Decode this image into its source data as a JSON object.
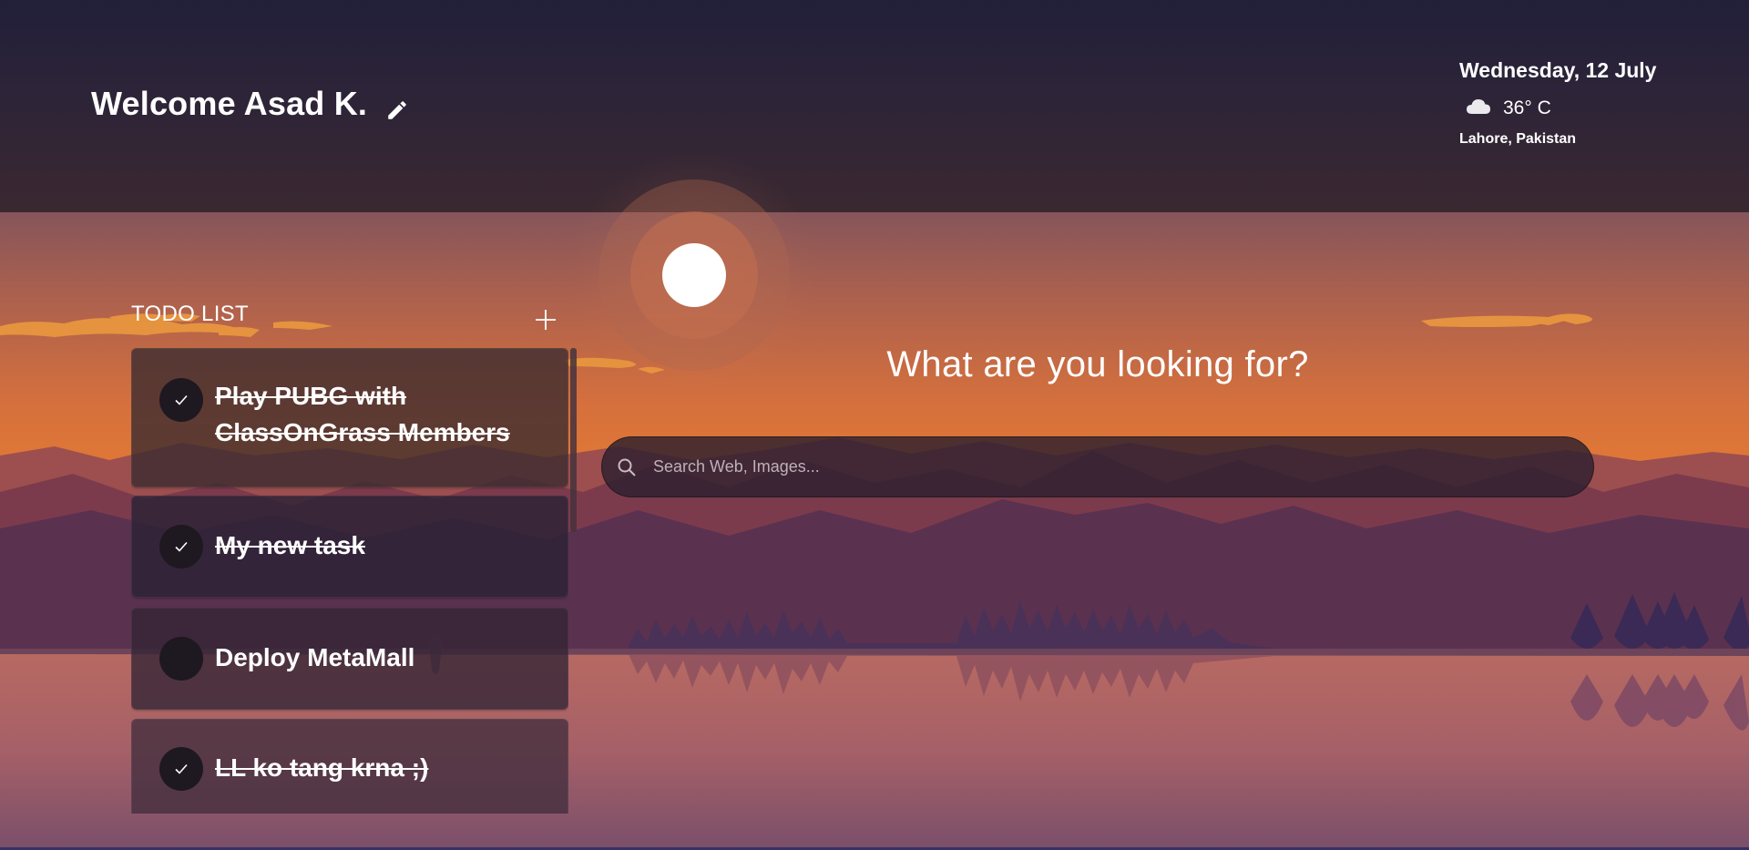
{
  "header": {
    "welcome_text": "Welcome Asad K.",
    "date": "Wednesday, 12 July",
    "temperature": "36° C",
    "location": "Lahore, Pakistan",
    "weather_icon": "cloud-icon",
    "edit_icon": "pencil-icon"
  },
  "todo": {
    "title": "TODO LIST",
    "add_icon": "plus-icon",
    "items": [
      {
        "label": "Play PUBG with ClassOnGrass Members",
        "done": true
      },
      {
        "label": "My new task",
        "done": true
      },
      {
        "label": "Deploy MetaMall",
        "done": false
      },
      {
        "label": "LL ko tang krna ;)",
        "done": true
      }
    ]
  },
  "search": {
    "heading": "What are you looking for?",
    "placeholder": "Search Web, Images...",
    "icon": "search-icon"
  },
  "colors": {
    "header_bg": "#221f39",
    "sky_orange": "#e07436",
    "mountain_purple": "#5a2f4e",
    "lake_pink": "#b26a62",
    "card_bg": "#3a2a36"
  }
}
